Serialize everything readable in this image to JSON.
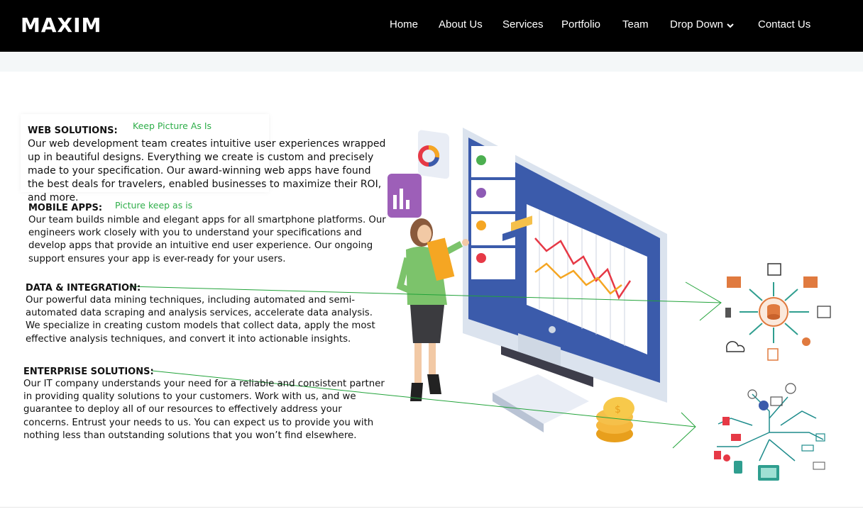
{
  "header": {
    "logo": "MAXIM",
    "nav": [
      "Home",
      "About Us",
      "Services",
      "Portfolio",
      "Team",
      "Drop Down",
      "Contact Us"
    ]
  },
  "sections": {
    "web": {
      "title": "WEB SOLUTIONS:",
      "note": "Keep Picture As Is",
      "body": "Our web development team creates intuitive user experiences wrapped up in beautiful designs. Everything we create is custom and precisely made to your specification. Our award-winning web apps have found the best deals for travelers, enabled businesses to maximize their ROI, and more."
    },
    "mobile": {
      "title": "MOBILE APPS:",
      "note": "Picture keep as is",
      "body": "Our team builds nimble and elegant apps for all smartphone platforms. Our engineers work closely with you to understand your specifications and develop apps that provide an intuitive end user experience. Our ongoing support ensures your app is ever-ready for your users."
    },
    "data": {
      "title": "DATA & INTEGRATION:",
      "body": "Our powerful data mining techniques, including automated and semi-automated data scraping and analysis services, accelerate data analysis. We specialize in creating custom models that collect data, apply the most effective analysis techniques, and convert it into actionable insights."
    },
    "enterprise": {
      "title": "ENTERPRISE SOLUTIONS:",
      "body": "Our IT company understands your need for a reliable and consistent partner in providing quality solutions to your customers. Work with us, and we guarantee to deploy all of our resources to effectively address your concerns. Entrust your needs to us. You can expect us to provide you with nothing less than outstanding solutions that you won’t find elsewhere."
    }
  },
  "colors": {
    "nav_bg": "#000000",
    "note_green": "#2fae4a",
    "arrow_green": "#22a33a",
    "monitor_blue": "#3b5bab",
    "chart_red": "#e63946",
    "chart_orange": "#f5a623"
  }
}
